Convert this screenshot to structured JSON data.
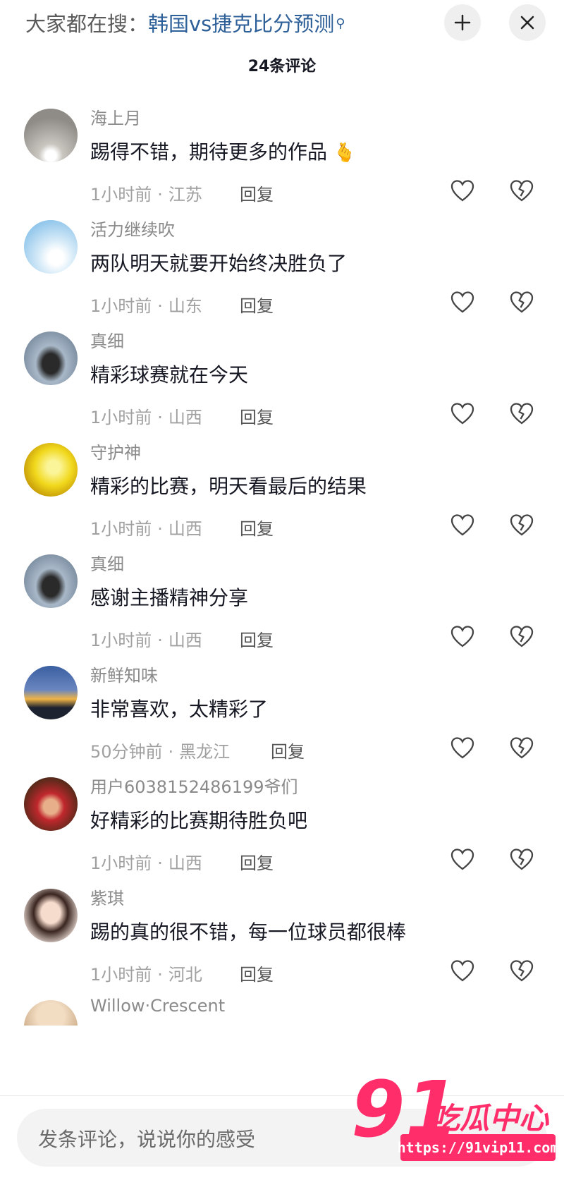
{
  "header": {
    "search_prefix": "大家都在搜：",
    "search_term": "韩国vs捷克比分预测",
    "search_icon": "search-icon",
    "collapse_icon": "collapse-icon",
    "close_icon": "close-icon",
    "comment_count": "24条评论"
  },
  "comments": [
    {
      "user": "海上月",
      "text": "踢得不错，期待更多的作品",
      "emoji": "🫰",
      "time": "1小时前",
      "location": "江苏",
      "reply": "回复"
    },
    {
      "user": "活力继续吹",
      "text": "两队明天就要开始终决胜负了",
      "emoji": "",
      "time": "1小时前",
      "location": "山东",
      "reply": "回复"
    },
    {
      "user": "真细",
      "text": "精彩球赛就在今天",
      "emoji": "",
      "time": "1小时前",
      "location": "山西",
      "reply": "回复"
    },
    {
      "user": "守护神",
      "text": "精彩的比赛，明天看最后的结果",
      "emoji": "",
      "time": "1小时前",
      "location": "山西",
      "reply": "回复"
    },
    {
      "user": "真细",
      "text": "感谢主播精神分享",
      "emoji": "",
      "time": "1小时前",
      "location": "山西",
      "reply": "回复"
    },
    {
      "user": "新鲜知味",
      "text": "非常喜欢，太精彩了",
      "emoji": "",
      "time": "50分钟前",
      "location": "黑龙江",
      "reply": "回复"
    },
    {
      "user": "用户6038152486199爷们",
      "text": "好精彩的比赛期待胜负吧",
      "emoji": "",
      "time": "1小时前",
      "location": "山西",
      "reply": "回复"
    },
    {
      "user": "紫琪",
      "text": "踢的真的很不错，每一位球员都很棒",
      "emoji": "",
      "time": "1小时前",
      "location": "河北",
      "reply": "回复"
    },
    {
      "user": "Willow·Crescent",
      "text": "",
      "emoji": "",
      "time": "",
      "location": "",
      "reply": ""
    }
  ],
  "input": {
    "placeholder": "发条评论，说说你的感受"
  },
  "watermark": {
    "number": "91",
    "text": "吃瓜中心",
    "url": "https://91vip11.com"
  },
  "colors": {
    "link_blue": "#2d5f98",
    "watermark_pink": "#ff2d6a",
    "muted_gray": "#a0a0a0"
  }
}
